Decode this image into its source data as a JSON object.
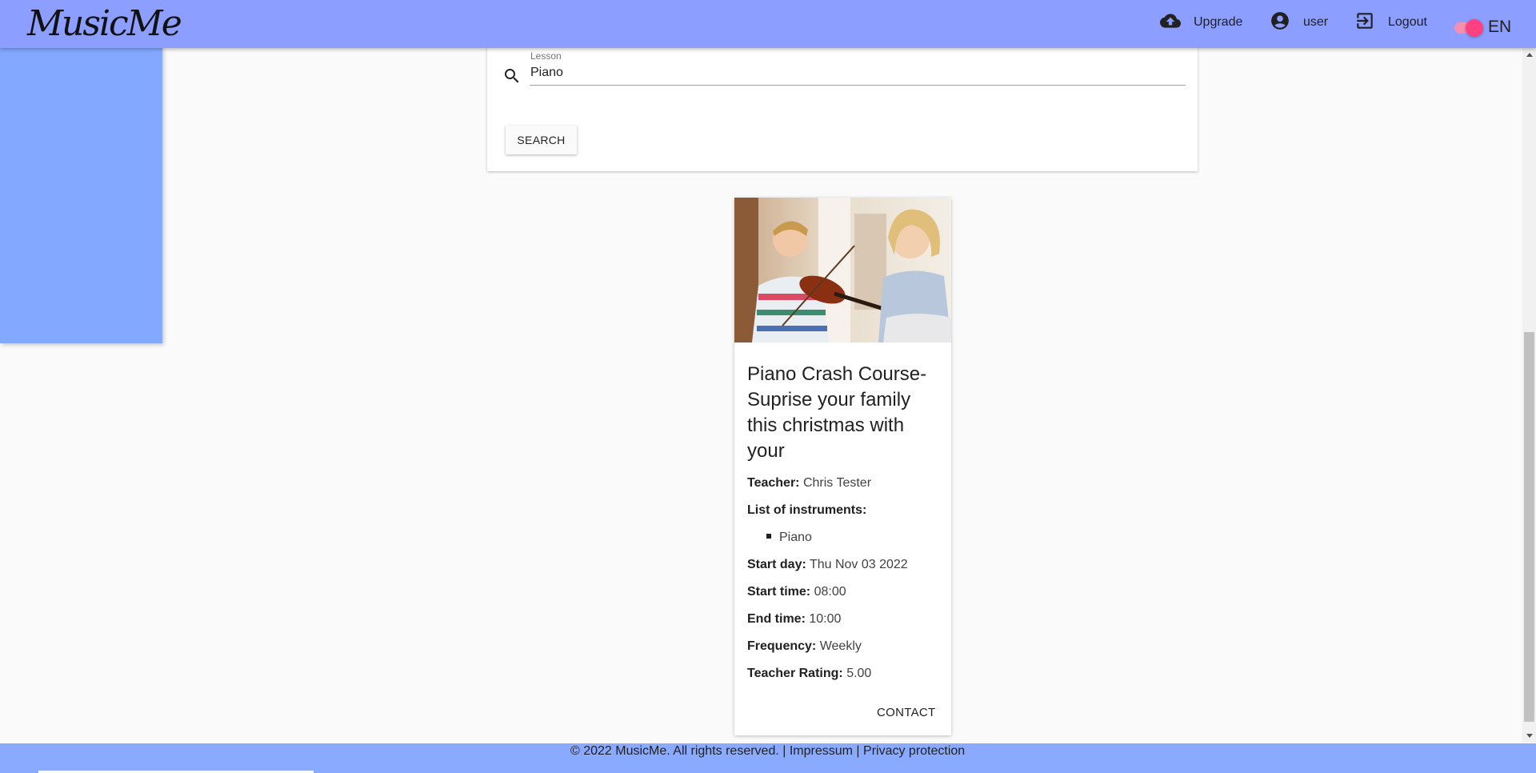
{
  "header": {
    "logo_text": "MusicMe",
    "upgrade_label": "Upgrade",
    "user_label": "user",
    "logout_label": "Logout",
    "language": "EN",
    "colors": {
      "appbar": "#8c9eff",
      "toggle": "#ff4081"
    }
  },
  "search": {
    "field_label": "Lesson",
    "field_value": "Piano",
    "button_label": "SEARCH"
  },
  "lesson": {
    "image_alt": "Teacher helping a boy play the violin",
    "title": "Piano Crash Course- Suprise your family this christmas with your",
    "teacher_label": "Teacher:",
    "teacher_value": "Chris Tester",
    "instruments_label": "List of instruments:",
    "instruments": [
      "Piano"
    ],
    "start_day_label": "Start day:",
    "start_day_value": "Thu Nov 03 2022",
    "start_time_label": "Start time:",
    "start_time_value": "08:00",
    "end_time_label": "End time:",
    "end_time_value": "10:00",
    "frequency_label": "Frequency:",
    "frequency_value": "Weekly",
    "rating_label": "Teacher Rating:",
    "rating_value": "5.00",
    "contact_label": "CONTACT"
  },
  "footer": {
    "copyright": "© 2022 MusicMe. All rights reserved.",
    "sep": "|",
    "impressum": "Impressum",
    "privacy": "Privacy protection"
  }
}
